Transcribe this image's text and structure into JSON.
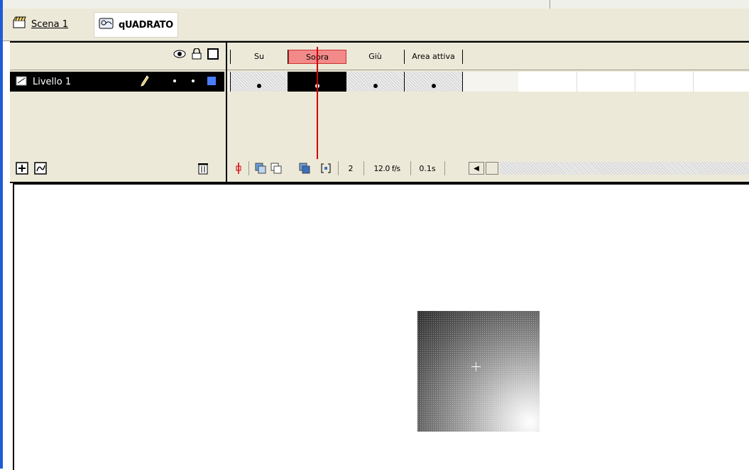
{
  "breadcrumb": {
    "scene_label": "Scena 1",
    "symbol_label": "qUADRATO"
  },
  "layers": {
    "header_icons": [
      "eye-icon",
      "lock-icon",
      "outline-icon"
    ],
    "items": [
      {
        "name": "Livello 1",
        "color": "#4a7cff"
      }
    ],
    "footer_icons": [
      "insert-layer-icon",
      "add-guide-layer-icon",
      "trash-icon"
    ]
  },
  "frames": {
    "labels": [
      "Su",
      "Sopra",
      "Giù",
      "Area attiva"
    ],
    "active_label": "Sopra",
    "current_frame": "2",
    "frame_rate": "12.0 f/s",
    "elapsed_time": "0.1s"
  },
  "colors": {
    "active_frame_label": "#f28a8a",
    "playhead": "#d00000",
    "panel_bg": "#ece9d8"
  }
}
